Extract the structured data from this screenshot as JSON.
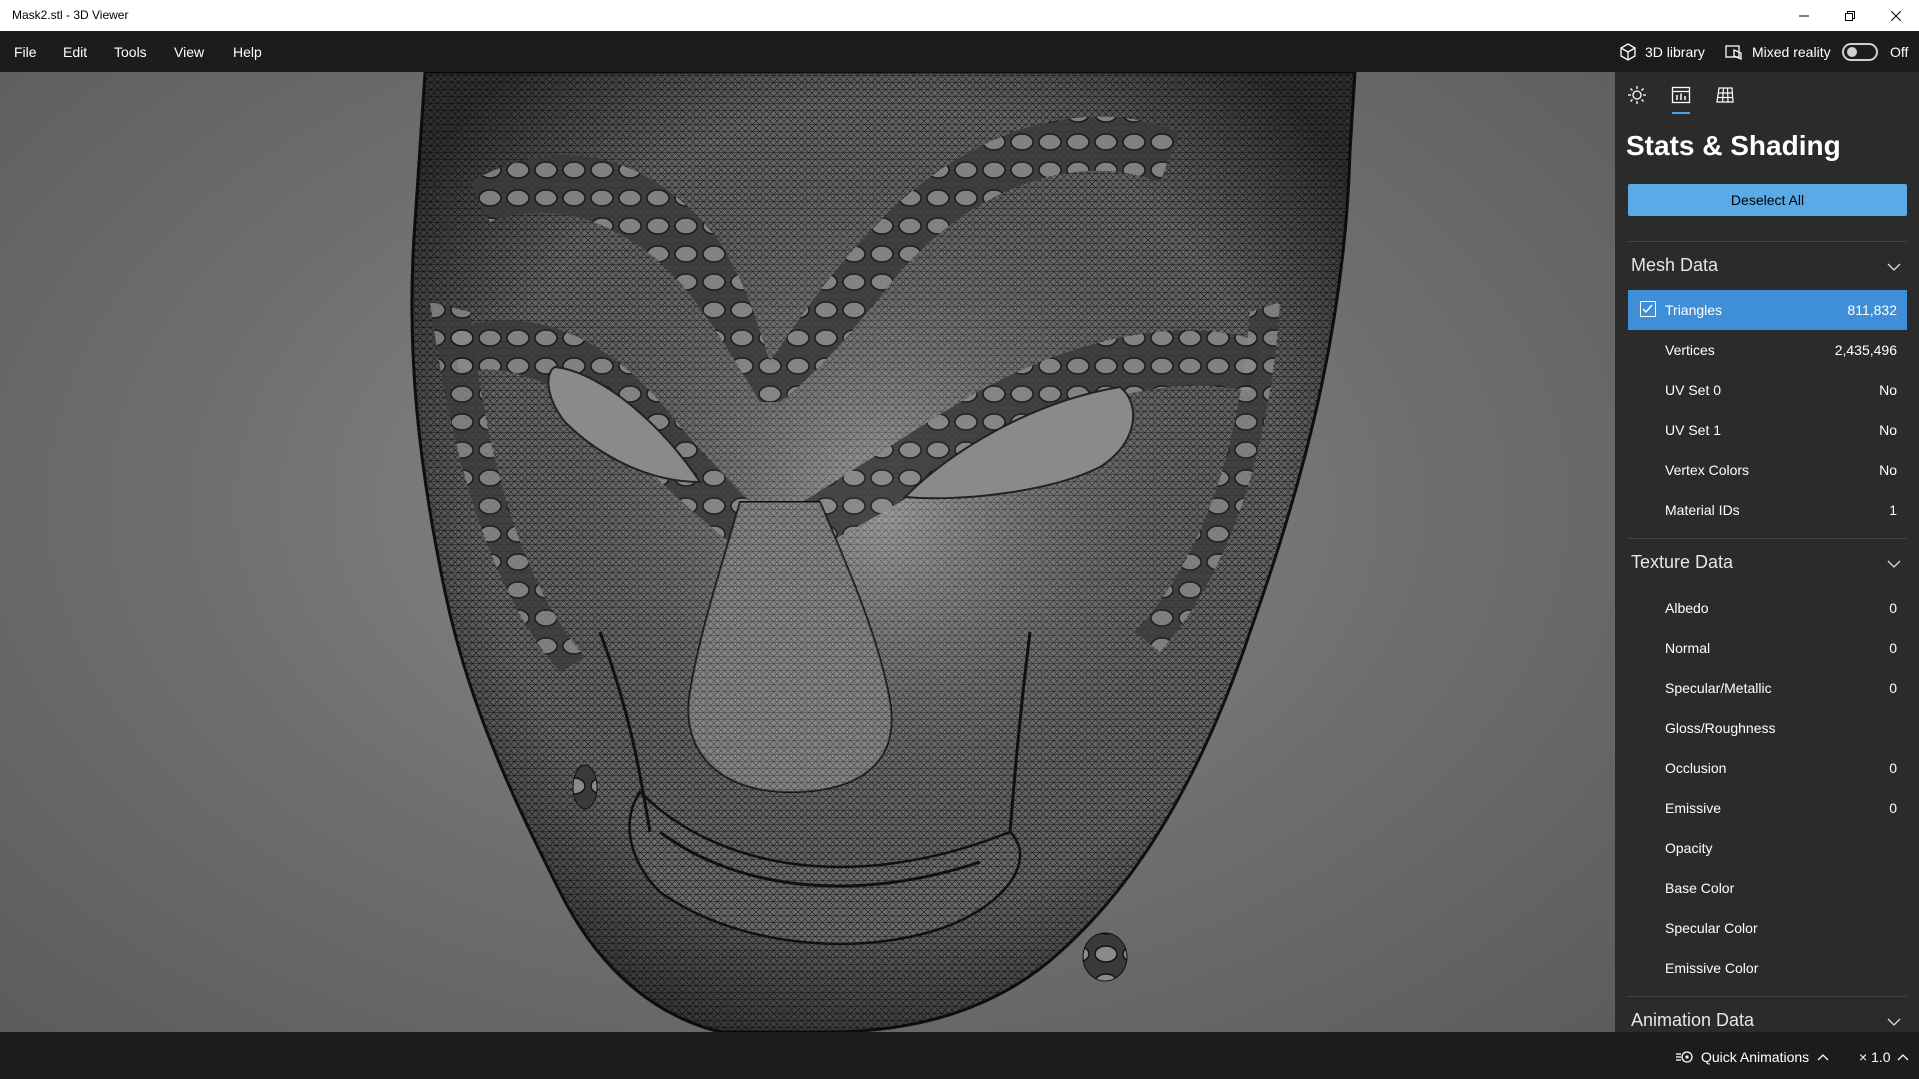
{
  "window": {
    "title": "Mask2.stl - 3D Viewer"
  },
  "menu": {
    "items": [
      "File",
      "Edit",
      "Tools",
      "View",
      "Help"
    ]
  },
  "toolbar": {
    "library_label": "3D library",
    "mixed_reality_label": "Mixed reality",
    "mixed_reality_state": "Off"
  },
  "panel": {
    "tabs": [
      "lighting-tab",
      "stats-shading-tab",
      "grid-tab"
    ],
    "title": "Stats & Shading",
    "deselect_label": "Deselect All",
    "mesh": {
      "title": "Mesh Data",
      "rows": [
        {
          "label": "Triangles",
          "value": "811,832"
        },
        {
          "label": "Vertices",
          "value": "2,435,496"
        },
        {
          "label": "UV Set 0",
          "value": "No"
        },
        {
          "label": "UV Set 1",
          "value": "No"
        },
        {
          "label": "Vertex Colors",
          "value": "No"
        },
        {
          "label": "Material IDs",
          "value": "1"
        }
      ]
    },
    "texture": {
      "title": "Texture Data",
      "rows": [
        {
          "label": "Albedo",
          "value": "0"
        },
        {
          "label": "Normal",
          "value": "0"
        },
        {
          "label": "Specular/Metallic",
          "value": "0"
        },
        {
          "label": "Gloss/Roughness",
          "value": ""
        },
        {
          "label": "Occlusion",
          "value": "0"
        },
        {
          "label": "Emissive",
          "value": "0"
        },
        {
          "label": "Opacity",
          "value": ""
        },
        {
          "label": "Base Color",
          "value": ""
        },
        {
          "label": "Specular Color",
          "value": ""
        },
        {
          "label": "Emissive Color",
          "value": ""
        }
      ]
    },
    "animation": {
      "title": "Animation Data"
    }
  },
  "status": {
    "quick_animations_label": "Quick Animations",
    "speed": "× 1.0"
  },
  "colors": {
    "accent": "#3f8fd8",
    "button": "#5aaae8",
    "panel_bg": "#2b2b2b",
    "chrome_bg": "#1c1c1c"
  }
}
